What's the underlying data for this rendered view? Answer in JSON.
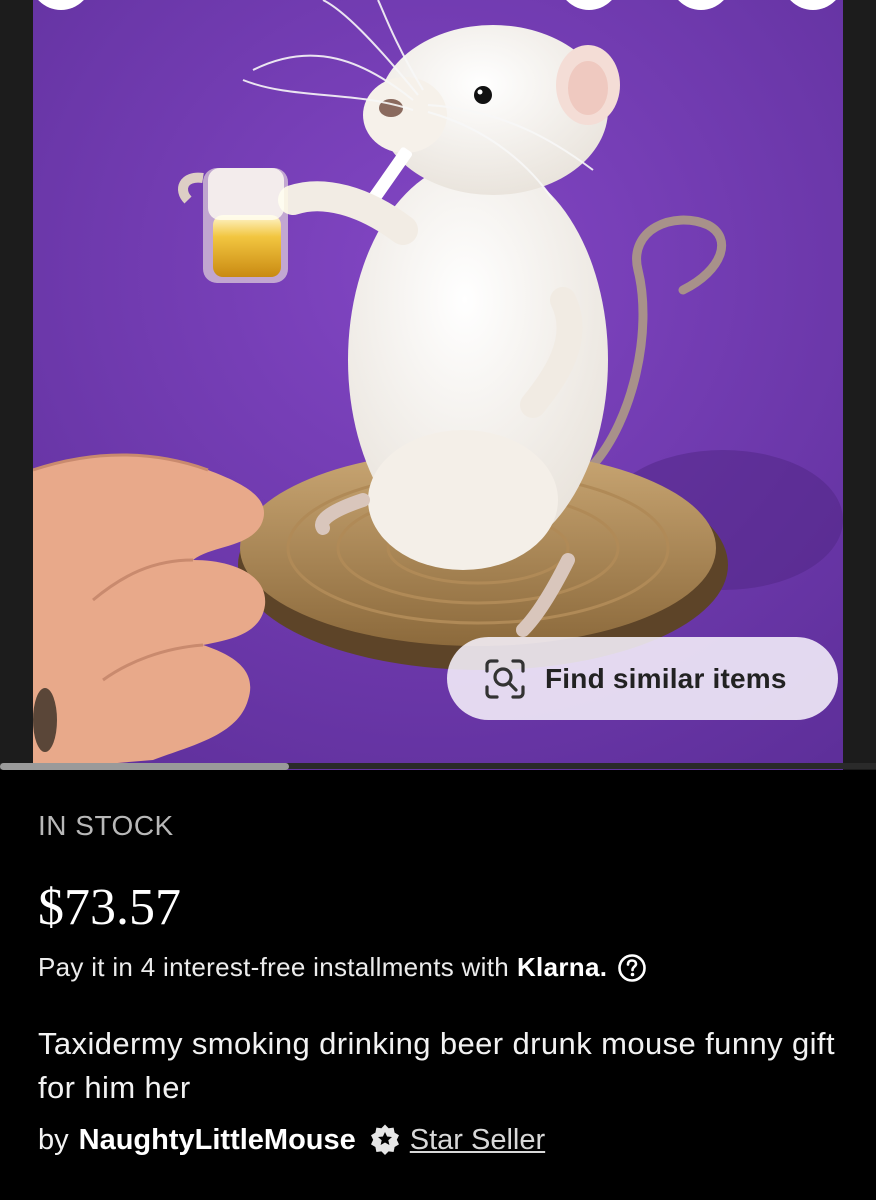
{
  "listing": {
    "find_similar_label": "Find similar items",
    "stock_status": "IN STOCK",
    "price": "$73.57",
    "installments_text": "Pay it in 4 interest-free installments with",
    "installments_brand": "Klarna.",
    "title": "Taxidermy smoking drinking beer drunk mouse funny gift for him her",
    "seller_prefix": "by",
    "seller_name": "NaughtyLittleMouse",
    "seller_badge": "Star Seller",
    "gallery_position": 0.33
  },
  "icons": {
    "visual_search": "visual-search-icon",
    "help": "question-circle-icon",
    "badge": "star-seller-badge-icon"
  },
  "colors": {
    "photo_background": "#6f3bb0",
    "page_background": "#000000",
    "pill_background": "#f5f0fa"
  }
}
